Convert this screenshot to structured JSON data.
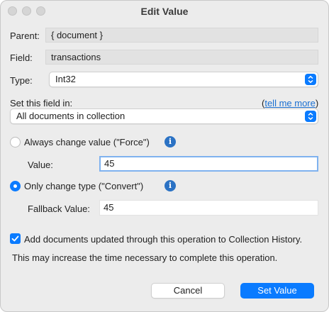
{
  "window": {
    "title": "Edit Value"
  },
  "parent": {
    "label": "Parent:",
    "value": "{ document }"
  },
  "field": {
    "label": "Field:",
    "value": "transactions"
  },
  "type": {
    "label": "Type:",
    "value": "Int32"
  },
  "scope": {
    "label": "Set this field in:",
    "paren_open": "(",
    "tell_more": "tell me more",
    "paren_close": ")",
    "value": "All documents in collection"
  },
  "force": {
    "label": "Always change value (\"Force\")",
    "selected": false,
    "value_label": "Value:",
    "value": "45"
  },
  "convert": {
    "label": "Only change type (\"Convert\")",
    "selected": true,
    "fallback_label": "Fallback Value:",
    "fallback_value": "45"
  },
  "history": {
    "label": "Add documents updated through this operation to Collection History.",
    "checked": true
  },
  "note": "This may increase the time necessary to complete this operation.",
  "info_glyph": "i",
  "buttons": {
    "cancel": "Cancel",
    "set": "Set Value"
  },
  "colors": {
    "accent": "#0a7bff",
    "info": "#2b72c4",
    "link": "#1a6fd1"
  }
}
